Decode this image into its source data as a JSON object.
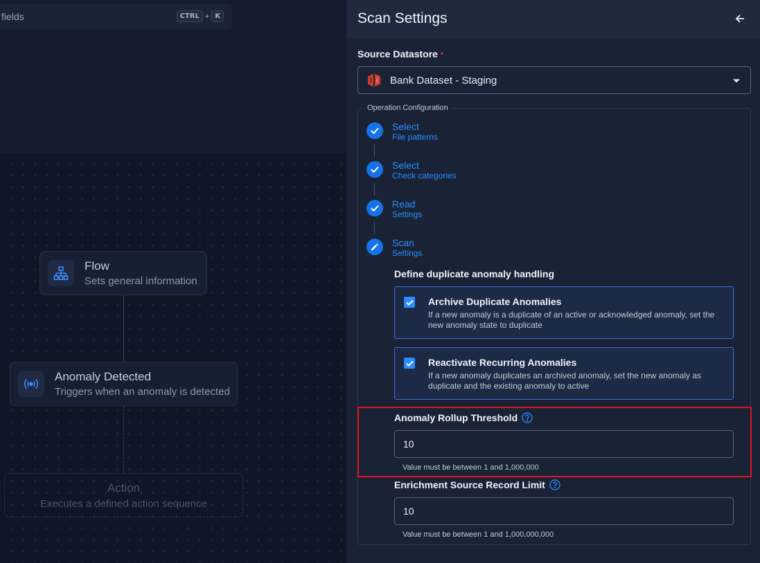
{
  "canvas": {
    "search": {
      "text": "fields",
      "shortcut_key1": "CTRL",
      "shortcut_plus": "+",
      "shortcut_key2": "K"
    },
    "nodes": {
      "flow": {
        "title": "Flow",
        "subtitle": "Sets general information",
        "icon": "sitemap-icon"
      },
      "anomaly": {
        "title": "Anomaly Detected",
        "subtitle": "Triggers when an anomaly is detected",
        "icon": "broadcast-icon"
      },
      "action": {
        "title": "Action",
        "subtitle": "Executes a defined action sequence"
      }
    }
  },
  "panel": {
    "title": "Scan Settings",
    "back_icon": "arrow-left-icon",
    "source": {
      "label": "Source Datastore",
      "required_marker": "•",
      "value": "Bank Dataset - Staging",
      "icon": "aws-s3-icon"
    },
    "operation": {
      "legend": "Operation Configuration",
      "steps": [
        {
          "title": "Select",
          "subtitle": "File patterns",
          "state": "completed"
        },
        {
          "title": "Select",
          "subtitle": "Check categories",
          "state": "completed"
        },
        {
          "title": "Read",
          "subtitle": "Settings",
          "state": "completed"
        },
        {
          "title": "Scan",
          "subtitle": "Settings",
          "state": "editing"
        }
      ],
      "duplicate_heading": "Define duplicate anomaly handling",
      "options": [
        {
          "title": "Archive Duplicate Anomalies",
          "description": "If a new anomaly is a duplicate of an active or acknowledged anomaly, set the new anomaly state to duplicate",
          "checked": true
        },
        {
          "title": "Reactivate Recurring Anomalies",
          "description": "If a new anomaly duplicates an archived anomaly, set the new anomaly as duplicate and the existing anomaly to active",
          "checked": true
        }
      ],
      "rollup": {
        "label": "Anomaly Rollup Threshold",
        "value": "10",
        "helper": "Value must be between 1 and 1,000,000"
      },
      "enrichment": {
        "label": "Enrichment Source Record Limit",
        "value": "10",
        "helper": "Value must be between 1 and 1,000,000,000"
      }
    }
  },
  "colors": {
    "accent": "#2a8cff",
    "highlight": "#e0141e",
    "required": "#e0245e"
  }
}
